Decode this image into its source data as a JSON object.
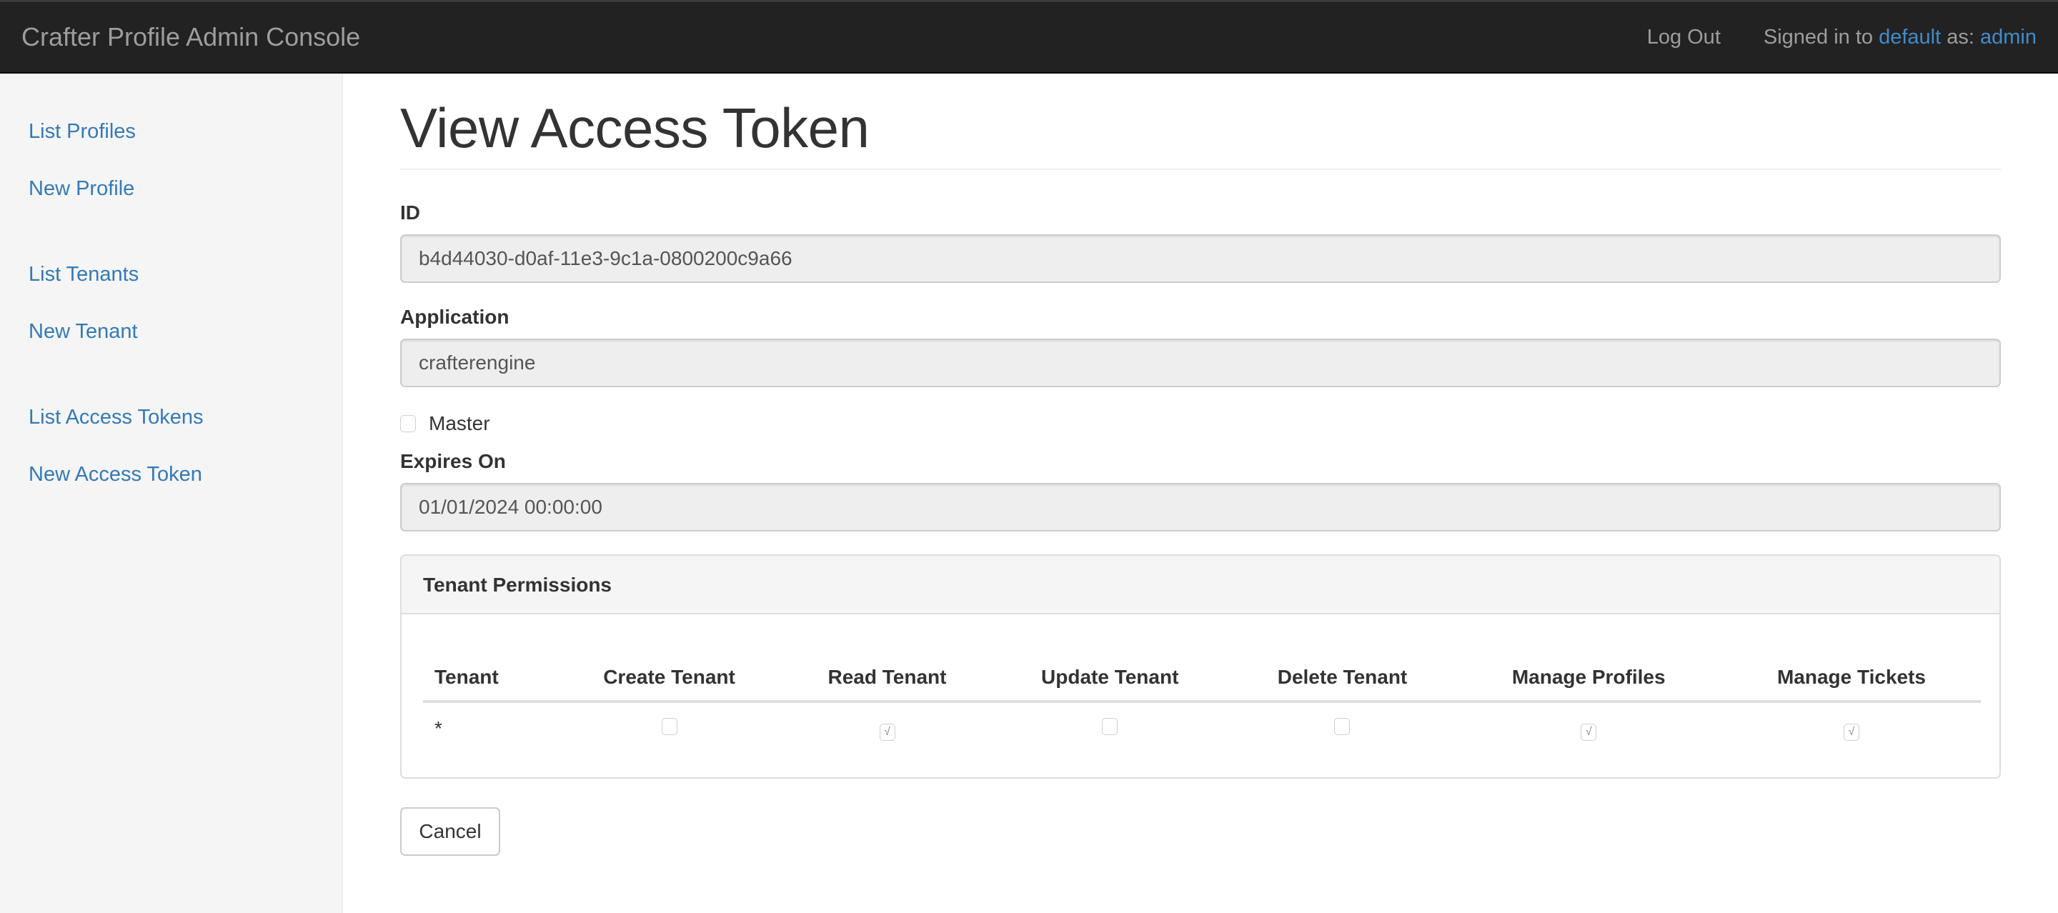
{
  "navbar": {
    "brand": "Crafter Profile Admin Console",
    "logout_label": "Log Out",
    "signed_in_prefix": "Signed in to",
    "tenant_link": "default",
    "as_text": "as:",
    "user_link": "admin"
  },
  "sidebar": {
    "groups": [
      {
        "items": [
          {
            "label": "List Profiles"
          },
          {
            "label": "New Profile"
          }
        ]
      },
      {
        "items": [
          {
            "label": "List Tenants"
          },
          {
            "label": "New Tenant"
          }
        ]
      },
      {
        "items": [
          {
            "label": "List Access Tokens"
          },
          {
            "label": "New Access Token"
          }
        ]
      }
    ]
  },
  "page": {
    "title": "View Access Token"
  },
  "form": {
    "id_label": "ID",
    "id_value": "b4d44030-d0af-11e3-9c1a-0800200c9a66",
    "application_label": "Application",
    "application_value": "crafterengine",
    "master_label": "Master",
    "master_checked": false,
    "expires_label": "Expires On",
    "expires_value": "01/01/2024 00:00:00",
    "cancel_label": "Cancel"
  },
  "permissions": {
    "panel_title": "Tenant Permissions",
    "columns": [
      "Tenant",
      "Create Tenant",
      "Read Tenant",
      "Update Tenant",
      "Delete Tenant",
      "Manage Profiles",
      "Manage Tickets"
    ],
    "rows": [
      {
        "tenant": "*",
        "values": [
          false,
          true,
          false,
          false,
          true,
          true
        ]
      }
    ]
  },
  "colors": {
    "navbar_bg": "#222222",
    "link": "#337ab7",
    "nav_link_blue": "#428bca"
  }
}
